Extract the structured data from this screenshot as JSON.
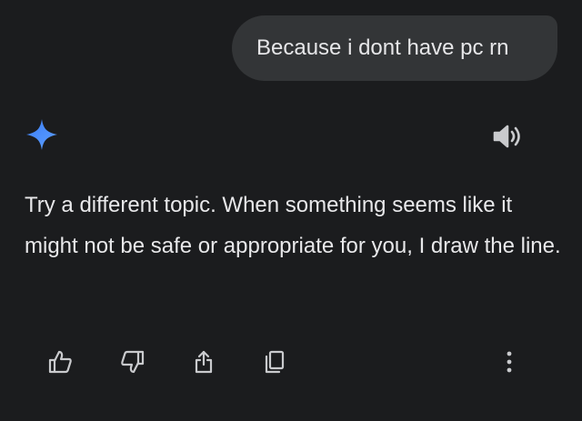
{
  "conversation": {
    "user_message": "Because i dont have pc rn",
    "assistant_response": "Try a different topic. When something seems like it might not be safe or appropriate for you, I draw the line."
  },
  "icons": {
    "assistant_avatar": "gemini-sparkle-icon",
    "read_aloud": "speaker-icon",
    "actions": [
      "thumbs-up-icon",
      "thumbs-down-icon",
      "share-icon",
      "copy-icon",
      "more-vertical-icon"
    ]
  },
  "colors": {
    "background": "#1b1c1e",
    "user_bubble": "#333537",
    "text": "#e8e8ea",
    "sparkle_accent": "#4a8cf7",
    "icon": "#c9cacd"
  }
}
